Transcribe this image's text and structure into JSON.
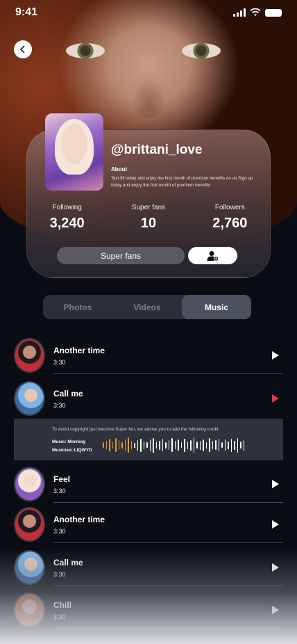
{
  "status_bar": {
    "time": "9:41"
  },
  "profile": {
    "username": "@brittani_love",
    "about_title": "About",
    "about_text": "Text fill  today and enjoy the first month of premium benefits on us.Sign up today and enjoy the first month of premium benefits",
    "stats": [
      {
        "label": "Following",
        "value": "3,240"
      },
      {
        "label": "Super fans",
        "value": "10"
      },
      {
        "label": "Followers",
        "value": "2,760"
      }
    ],
    "superfans_button": "Super fans"
  },
  "tabs": [
    {
      "label": "Photos",
      "active": false
    },
    {
      "label": "Videos",
      "active": false
    },
    {
      "label": "Music",
      "active": true
    }
  ],
  "tracks": [
    {
      "name": "Another time",
      "duration": "3:30",
      "playing": false
    },
    {
      "name": "Call me",
      "duration": "3:30",
      "playing": true
    },
    {
      "name": "Feel",
      "duration": "3:30",
      "playing": false
    },
    {
      "name": "Another time",
      "duration": "3:30",
      "playing": false
    },
    {
      "name": "Call me",
      "duration": "3:30",
      "playing": false
    },
    {
      "name": "Chill",
      "duration": "3:30",
      "playing": false
    }
  ],
  "credit": {
    "note": "To avoid copyright just become Super fan, we advise you to add the following credit",
    "music": "Music: Morning",
    "musician": "Musician: LIQWYD"
  },
  "colors": {
    "accent_red": "#e53946",
    "wave_played": "#e09a2a",
    "background": "#0a0d14"
  }
}
